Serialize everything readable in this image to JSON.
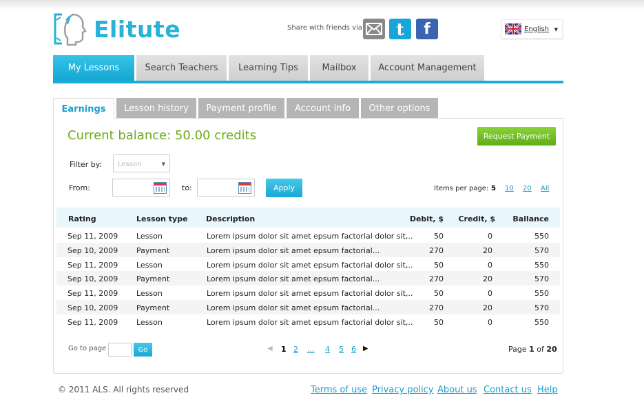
{
  "header": {
    "logo_text": "Elitute",
    "share_label": "Share with friends via:",
    "share_icons": [
      "mail-icon",
      "twitter-icon",
      "facebook-icon"
    ],
    "language": "English"
  },
  "main_nav": [
    {
      "label": "My Lessons",
      "active": true
    },
    {
      "label": "Search Teachers"
    },
    {
      "label": "Learning Tips"
    },
    {
      "label": "Mailbox"
    },
    {
      "label": "Account Management"
    }
  ],
  "sub_tabs": [
    {
      "label": "Earnings",
      "active": true
    },
    {
      "label": "Lesson history"
    },
    {
      "label": "Payment profile"
    },
    {
      "label": "Account info"
    },
    {
      "label": "Other options"
    }
  ],
  "balance_text": "Current balance: 50.00 credits",
  "request_payment_label": "Request Payment",
  "filter": {
    "filter_label": "Filter by:",
    "filter_value": "Lesson",
    "from_label": "From:",
    "to_label": "to:",
    "apply_label": "Apply"
  },
  "items_per_page": {
    "label": "Items per page:",
    "options": [
      "5",
      "10",
      "20",
      "All"
    ],
    "selected": "5"
  },
  "table": {
    "headers": [
      "Rating",
      "Lesson type",
      "Description",
      "Debit, $",
      "Credit, $",
      "Ballance"
    ],
    "rows": [
      [
        "Sep 11, 2009",
        "Lesson",
        "Lorem ipsum dolor sit amet epsum factorial dolor sit,..",
        "50",
        "0",
        "550"
      ],
      [
        "Sep 10, 2009",
        "Payment",
        "Lorem ipsum dolor sit amet epsum factorial...",
        "270",
        "20",
        "570"
      ],
      [
        "Sep 11, 2009",
        "Lesson",
        "Lorem ipsum dolor sit amet epsum factorial dolor sit,..",
        "50",
        "0",
        "550"
      ],
      [
        "Sep 10, 2009",
        "Payment",
        "Lorem ipsum dolor sit amet epsum factorial...",
        "270",
        "20",
        "570"
      ],
      [
        "Sep 11, 2009",
        "Lesson",
        "Lorem ipsum dolor sit amet epsum factorial dolor sit,..",
        "50",
        "0",
        "550"
      ],
      [
        "Sep 10, 2009",
        "Payment",
        "Lorem ipsum dolor sit amet epsum factorial...",
        "270",
        "20",
        "570"
      ],
      [
        "Sep 11, 2009",
        "Lesson",
        "Lorem ipsum dolor sit amet epsum factorial dolor sit,..",
        "50",
        "0",
        "550"
      ]
    ]
  },
  "pagination": {
    "goto_label": "Go to page",
    "go_label": "Go",
    "pages": [
      "1",
      "2",
      "...",
      "4",
      "5",
      "6"
    ],
    "current": "1",
    "page_prefix": "Page",
    "page_current": "1",
    "page_of": "of",
    "page_total": "20"
  },
  "footer": {
    "copyright": "© 2011 ALS. All rights reserved",
    "links": [
      "Terms of use",
      "Privacy policy",
      "About us",
      "Contact us",
      "Help"
    ]
  },
  "colors": {
    "accent": "#18aed8",
    "balance_green": "#6cac1a",
    "request_green": "#6fbf21",
    "twitter": "#1aa5d8",
    "facebook": "#3a63b0",
    "mail": "#888888"
  }
}
